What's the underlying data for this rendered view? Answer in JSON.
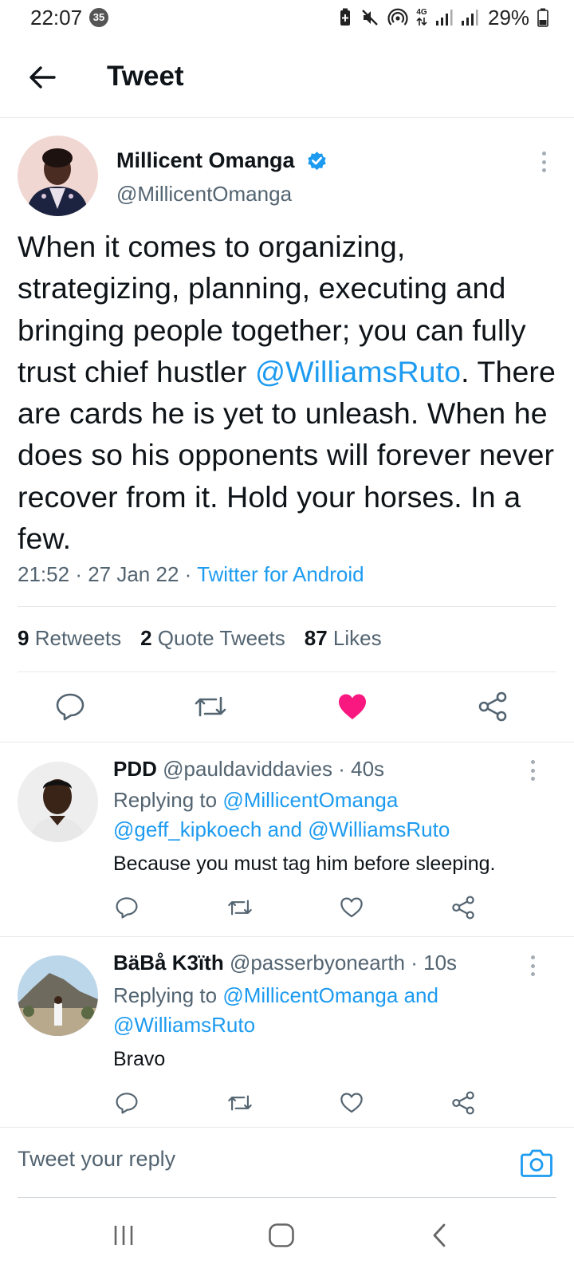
{
  "status_bar": {
    "time": "22:07",
    "notification_count": "35",
    "network": "4G",
    "battery_percent": "29%"
  },
  "header": {
    "title": "Tweet"
  },
  "tweet": {
    "author_name": "Millicent Omanga",
    "author_handle": "@MillicentOmanga",
    "verified": true,
    "text_part1": "When it comes to organizing, strategizing, planning, executing and bringing people together; you can fully trust chief hustler ",
    "mention": "@WilliamsRuto",
    "text_part2": ". There are cards he is yet to unleash. When he does so his opponents will forever never recover from it. Hold your horses. In a few.",
    "time": "21:52",
    "date": "27 Jan 22",
    "source": "Twitter for Android",
    "retweets_count": "9",
    "retweets_label": "Retweets",
    "quotes_count": "2",
    "quotes_label": "Quote Tweets",
    "likes_count": "87",
    "likes_label": "Likes",
    "liked": true,
    "like_color": "#f91880"
  },
  "replies": [
    {
      "name": "PDD",
      "handle": "@pauldaviddavies",
      "age": "40s",
      "replying_prefix": "Replying to",
      "replying_line1": "@MillicentOmanga",
      "replying_line2_a": "@geff_kipkoech",
      "replying_line2_and": "and",
      "replying_line2_b": "@WilliamsRuto",
      "text": "Because you must tag him before sleeping."
    },
    {
      "name": "BäBå K3ïth",
      "handle": "@passerbyonearth",
      "age": "10s",
      "replying_prefix": "Replying to",
      "replying_line1_a": "@MillicentOmanga",
      "replying_line1_and": "and",
      "replying_line2": "@WilliamsRuto",
      "text": "Bravo"
    }
  ],
  "composer": {
    "placeholder": "Tweet your reply"
  },
  "colors": {
    "accent": "#1d9bf0",
    "text_secondary": "#536471"
  }
}
